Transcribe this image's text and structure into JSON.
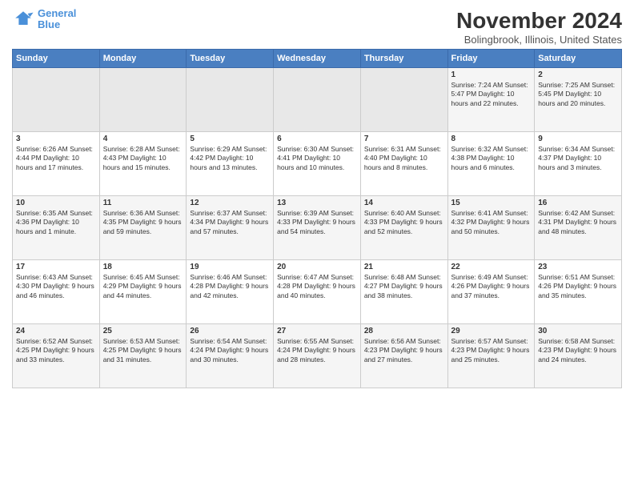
{
  "header": {
    "logo_line1": "General",
    "logo_line2": "Blue",
    "month": "November 2024",
    "location": "Bolingbrook, Illinois, United States"
  },
  "days_of_week": [
    "Sunday",
    "Monday",
    "Tuesday",
    "Wednesday",
    "Thursday",
    "Friday",
    "Saturday"
  ],
  "weeks": [
    [
      {
        "day": "",
        "info": ""
      },
      {
        "day": "",
        "info": ""
      },
      {
        "day": "",
        "info": ""
      },
      {
        "day": "",
        "info": ""
      },
      {
        "day": "",
        "info": ""
      },
      {
        "day": "1",
        "info": "Sunrise: 7:24 AM\nSunset: 5:47 PM\nDaylight: 10 hours and 22 minutes."
      },
      {
        "day": "2",
        "info": "Sunrise: 7:25 AM\nSunset: 5:45 PM\nDaylight: 10 hours and 20 minutes."
      }
    ],
    [
      {
        "day": "3",
        "info": "Sunrise: 6:26 AM\nSunset: 4:44 PM\nDaylight: 10 hours and 17 minutes."
      },
      {
        "day": "4",
        "info": "Sunrise: 6:28 AM\nSunset: 4:43 PM\nDaylight: 10 hours and 15 minutes."
      },
      {
        "day": "5",
        "info": "Sunrise: 6:29 AM\nSunset: 4:42 PM\nDaylight: 10 hours and 13 minutes."
      },
      {
        "day": "6",
        "info": "Sunrise: 6:30 AM\nSunset: 4:41 PM\nDaylight: 10 hours and 10 minutes."
      },
      {
        "day": "7",
        "info": "Sunrise: 6:31 AM\nSunset: 4:40 PM\nDaylight: 10 hours and 8 minutes."
      },
      {
        "day": "8",
        "info": "Sunrise: 6:32 AM\nSunset: 4:38 PM\nDaylight: 10 hours and 6 minutes."
      },
      {
        "day": "9",
        "info": "Sunrise: 6:34 AM\nSunset: 4:37 PM\nDaylight: 10 hours and 3 minutes."
      }
    ],
    [
      {
        "day": "10",
        "info": "Sunrise: 6:35 AM\nSunset: 4:36 PM\nDaylight: 10 hours and 1 minute."
      },
      {
        "day": "11",
        "info": "Sunrise: 6:36 AM\nSunset: 4:35 PM\nDaylight: 9 hours and 59 minutes."
      },
      {
        "day": "12",
        "info": "Sunrise: 6:37 AM\nSunset: 4:34 PM\nDaylight: 9 hours and 57 minutes."
      },
      {
        "day": "13",
        "info": "Sunrise: 6:39 AM\nSunset: 4:33 PM\nDaylight: 9 hours and 54 minutes."
      },
      {
        "day": "14",
        "info": "Sunrise: 6:40 AM\nSunset: 4:33 PM\nDaylight: 9 hours and 52 minutes."
      },
      {
        "day": "15",
        "info": "Sunrise: 6:41 AM\nSunset: 4:32 PM\nDaylight: 9 hours and 50 minutes."
      },
      {
        "day": "16",
        "info": "Sunrise: 6:42 AM\nSunset: 4:31 PM\nDaylight: 9 hours and 48 minutes."
      }
    ],
    [
      {
        "day": "17",
        "info": "Sunrise: 6:43 AM\nSunset: 4:30 PM\nDaylight: 9 hours and 46 minutes."
      },
      {
        "day": "18",
        "info": "Sunrise: 6:45 AM\nSunset: 4:29 PM\nDaylight: 9 hours and 44 minutes."
      },
      {
        "day": "19",
        "info": "Sunrise: 6:46 AM\nSunset: 4:28 PM\nDaylight: 9 hours and 42 minutes."
      },
      {
        "day": "20",
        "info": "Sunrise: 6:47 AM\nSunset: 4:28 PM\nDaylight: 9 hours and 40 minutes."
      },
      {
        "day": "21",
        "info": "Sunrise: 6:48 AM\nSunset: 4:27 PM\nDaylight: 9 hours and 38 minutes."
      },
      {
        "day": "22",
        "info": "Sunrise: 6:49 AM\nSunset: 4:26 PM\nDaylight: 9 hours and 37 minutes."
      },
      {
        "day": "23",
        "info": "Sunrise: 6:51 AM\nSunset: 4:26 PM\nDaylight: 9 hours and 35 minutes."
      }
    ],
    [
      {
        "day": "24",
        "info": "Sunrise: 6:52 AM\nSunset: 4:25 PM\nDaylight: 9 hours and 33 minutes."
      },
      {
        "day": "25",
        "info": "Sunrise: 6:53 AM\nSunset: 4:25 PM\nDaylight: 9 hours and 31 minutes."
      },
      {
        "day": "26",
        "info": "Sunrise: 6:54 AM\nSunset: 4:24 PM\nDaylight: 9 hours and 30 minutes."
      },
      {
        "day": "27",
        "info": "Sunrise: 6:55 AM\nSunset: 4:24 PM\nDaylight: 9 hours and 28 minutes."
      },
      {
        "day": "28",
        "info": "Sunrise: 6:56 AM\nSunset: 4:23 PM\nDaylight: 9 hours and 27 minutes."
      },
      {
        "day": "29",
        "info": "Sunrise: 6:57 AM\nSunset: 4:23 PM\nDaylight: 9 hours and 25 minutes."
      },
      {
        "day": "30",
        "info": "Sunrise: 6:58 AM\nSunset: 4:23 PM\nDaylight: 9 hours and 24 minutes."
      }
    ]
  ]
}
